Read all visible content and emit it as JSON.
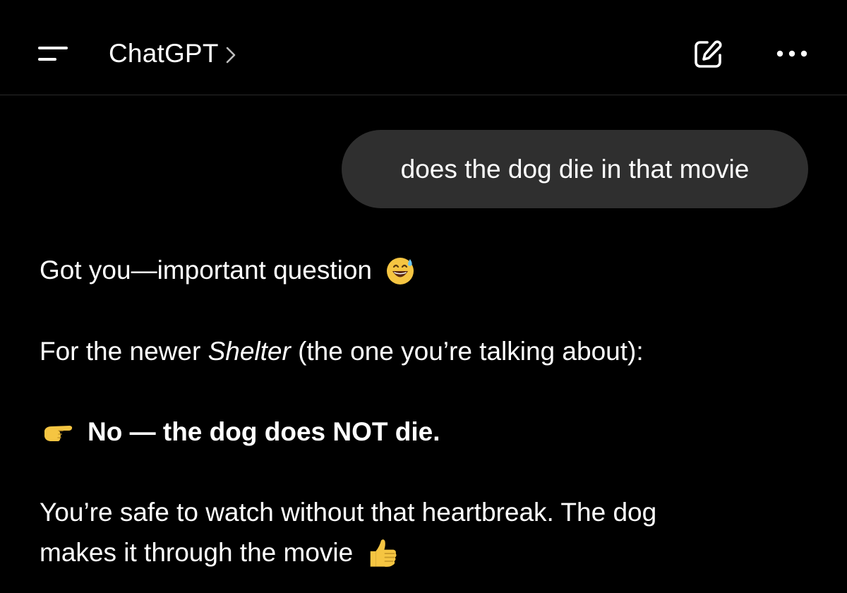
{
  "header": {
    "title": "ChatGPT",
    "chevron": ">",
    "menu_icon": "menu-icon",
    "new_chat_icon": "edit-icon",
    "more_icon": "more-horizontal-icon"
  },
  "conversation": {
    "user_message": "does the dog die in that movie",
    "assistant": {
      "line1": {
        "text": "Got you—important question",
        "emoji": "sweat-smile-emoji"
      },
      "line2": {
        "before": "For the newer ",
        "title": "Shelter",
        "after": " (the one you’re talking about):"
      },
      "line3": {
        "emoji": "pointing-right-emoji",
        "text": "No — the dog does NOT die."
      },
      "line4": {
        "text": "You’re safe to watch without that heartbreak. The dog"
      },
      "line5": {
        "text": "makes it through the movie",
        "emoji": "thumbs-up-emoji"
      }
    }
  },
  "colors": {
    "background": "#000000",
    "bubble": "#2f2f2f",
    "text": "#ffffff",
    "divider": "#2a2a2a",
    "emoji_yellow": "#f5c542"
  }
}
